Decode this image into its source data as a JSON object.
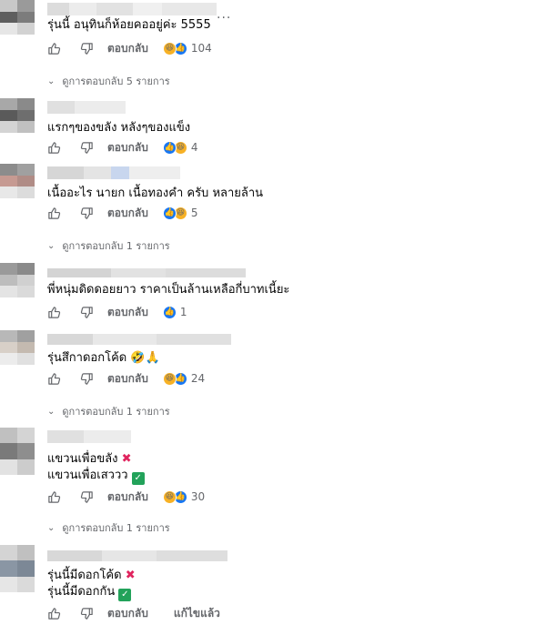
{
  "ui": {
    "reply_label": "ตอบกลับ",
    "edited_label": "แก้ไขแล้ว",
    "more_label": "···"
  },
  "colors": {
    "meta_text": "#65676b",
    "like_blue": "#1877f2",
    "haha_yellow": "#f7b125",
    "check_green": "#22a25a",
    "cross_red": "#e0245e"
  },
  "comments": [
    {
      "text": "รุ่นนี้ อนุทินก็ห้อยคออยู่ค่ะ 5555",
      "reactions": [
        "haha-icon",
        "like-icon"
      ],
      "count": "104",
      "replies": "ดูการตอบกลับ 5 รายการ"
    },
    {
      "text": "แรกๆของขลัง หลังๆของแข็ง",
      "reactions": [
        "like-icon",
        "haha-icon"
      ],
      "count": "4"
    },
    {
      "text": "เนื้ออะไร นายก เนื้อทองคำ ครับ หลายล้าน",
      "reactions": [
        "like-icon",
        "haha-icon"
      ],
      "count": "5",
      "replies": "ดูการตอบกลับ 1 รายการ"
    },
    {
      "text": "พี่หนุ่มดิดดอยยาว ราคาเป็นล้านเหลือกี่บาทเนี้ยะ",
      "reactions": [
        "like-icon"
      ],
      "count": "1"
    },
    {
      "text": "รุ่นสึกาดอกโค้ด 🤣🙏",
      "reactions": [
        "haha-icon",
        "like-icon"
      ],
      "count": "24",
      "replies": "ดูการตอบกลับ 1 รายการ"
    },
    {
      "line1": "แขวนเพื่อขลัง",
      "line2": "แขวนเพื่อเสววว",
      "reactions": [
        "haha-icon",
        "like-icon"
      ],
      "count": "30",
      "replies": "ดูการตอบกลับ 1 รายการ"
    },
    {
      "line1": "รุ่นนี้มีดอกโค้ด",
      "line2": "รุ่นนี้มีดอกกัน"
    }
  ]
}
